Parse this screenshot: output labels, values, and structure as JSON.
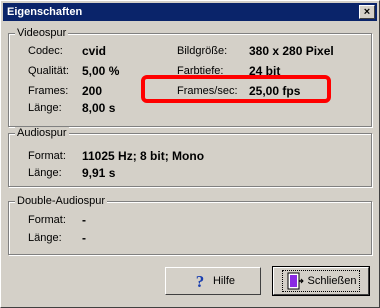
{
  "window": {
    "title": "Eigenschaften",
    "close_glyph": "×"
  },
  "video": {
    "legend": "Videospur",
    "codec_label": "Codec:",
    "codec_value": "cvid",
    "quality_label": "Qualität:",
    "quality_value": "5,00 %",
    "frames_label": "Frames:",
    "frames_value": "200",
    "length_label": "Länge:",
    "length_value": "8,00 s",
    "size_label": "Bildgröße:",
    "size_value": "380 x 280 Pixel",
    "depth_label": "Farbtiefe:",
    "depth_value": "24 bit",
    "fps_label": "Frames/sec:",
    "fps_value": "25,00 fps"
  },
  "audio": {
    "legend": "Audiospur",
    "format_label": "Format:",
    "format_value": "11025 Hz; 8 bit; Mono",
    "length_label": "Länge:",
    "length_value": "9,91 s"
  },
  "double_audio": {
    "legend": "Double-Audiospur",
    "format_label": "Format:",
    "format_value": "-",
    "length_label": "Länge:",
    "length_value": "-"
  },
  "buttons": {
    "help_label": "Hilfe",
    "close_label": "Schließen"
  },
  "colors": {
    "titlebar": "#0a246a",
    "highlight": "#ff0000",
    "face": "#d4d0c8"
  },
  "icons": {
    "help": "question-icon",
    "close": "door-exit-icon"
  }
}
